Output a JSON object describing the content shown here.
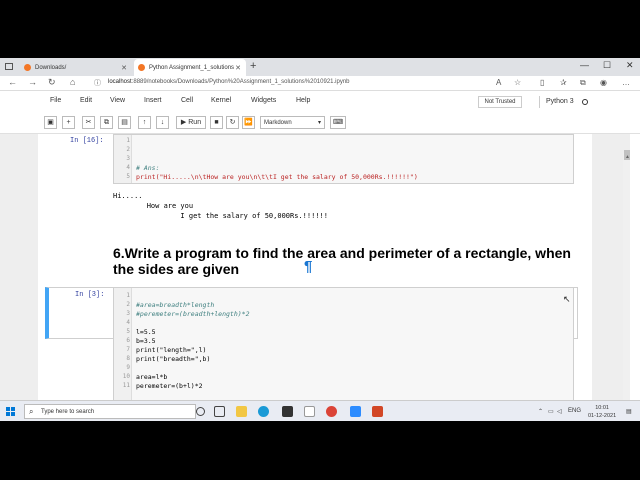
{
  "browser": {
    "tabs": [
      {
        "label": "Downloads/",
        "active": false
      },
      {
        "label": "Python Assignment_1_solutions",
        "active": true
      }
    ],
    "url_host": "localhost",
    "url_rest": ":8889/notebooks/Downloads/Python%20Assignment_1_solutions%2010921.ipynb"
  },
  "jupyter": {
    "menus": [
      "File",
      "Edit",
      "View",
      "Insert",
      "Cell",
      "Kernel",
      "Widgets",
      "Help"
    ],
    "trust_status": "Not Trusted",
    "kernel_name": "Python 3",
    "run_label": "Run",
    "cell_type": "Markdown"
  },
  "cells": {
    "cell16": {
      "prompt": "In [16]:",
      "lines": [
        {
          "n": "1",
          "text": ""
        },
        {
          "n": "2",
          "text": ""
        },
        {
          "n": "3",
          "text": ""
        },
        {
          "n": "4",
          "text": "# Ans:"
        },
        {
          "n": "5",
          "text": "print(\"Hi.....\\n\\tHow are you\\n\\t\\tI get the salary of 50,000Rs.!!!!!!\")"
        }
      ],
      "output": [
        "Hi.....",
        "        How are you",
        "                I get the salary of 50,000Rs.!!!!!!"
      ]
    },
    "markdown": {
      "text": "6.Write a program to find the area and perimeter of a rectangle, when the sides are given",
      "pilcrow": "¶"
    },
    "cell3": {
      "prompt": "In [3]:",
      "lines": [
        {
          "n": "1",
          "text": ""
        },
        {
          "n": "2",
          "text": "#area=breadth*length"
        },
        {
          "n": "3",
          "text": "#peremeter=(breadth+length)*2"
        },
        {
          "n": "4",
          "text": ""
        },
        {
          "n": "5",
          "text": "l=5.5"
        },
        {
          "n": "6",
          "text": "b=3.5"
        },
        {
          "n": "7",
          "text": "print(\"length=\",l)"
        },
        {
          "n": "8",
          "text": "print(\"breadth=\",b)"
        },
        {
          "n": "9",
          "text": ""
        },
        {
          "n": "10",
          "text": "area=l*b"
        },
        {
          "n": "11",
          "text": "peremeter=(b+l)*2"
        }
      ]
    }
  },
  "taskbar": {
    "search_placeholder": "Type here to search",
    "lang": "ENG",
    "time": "10:01",
    "date": "01-12-2021"
  }
}
